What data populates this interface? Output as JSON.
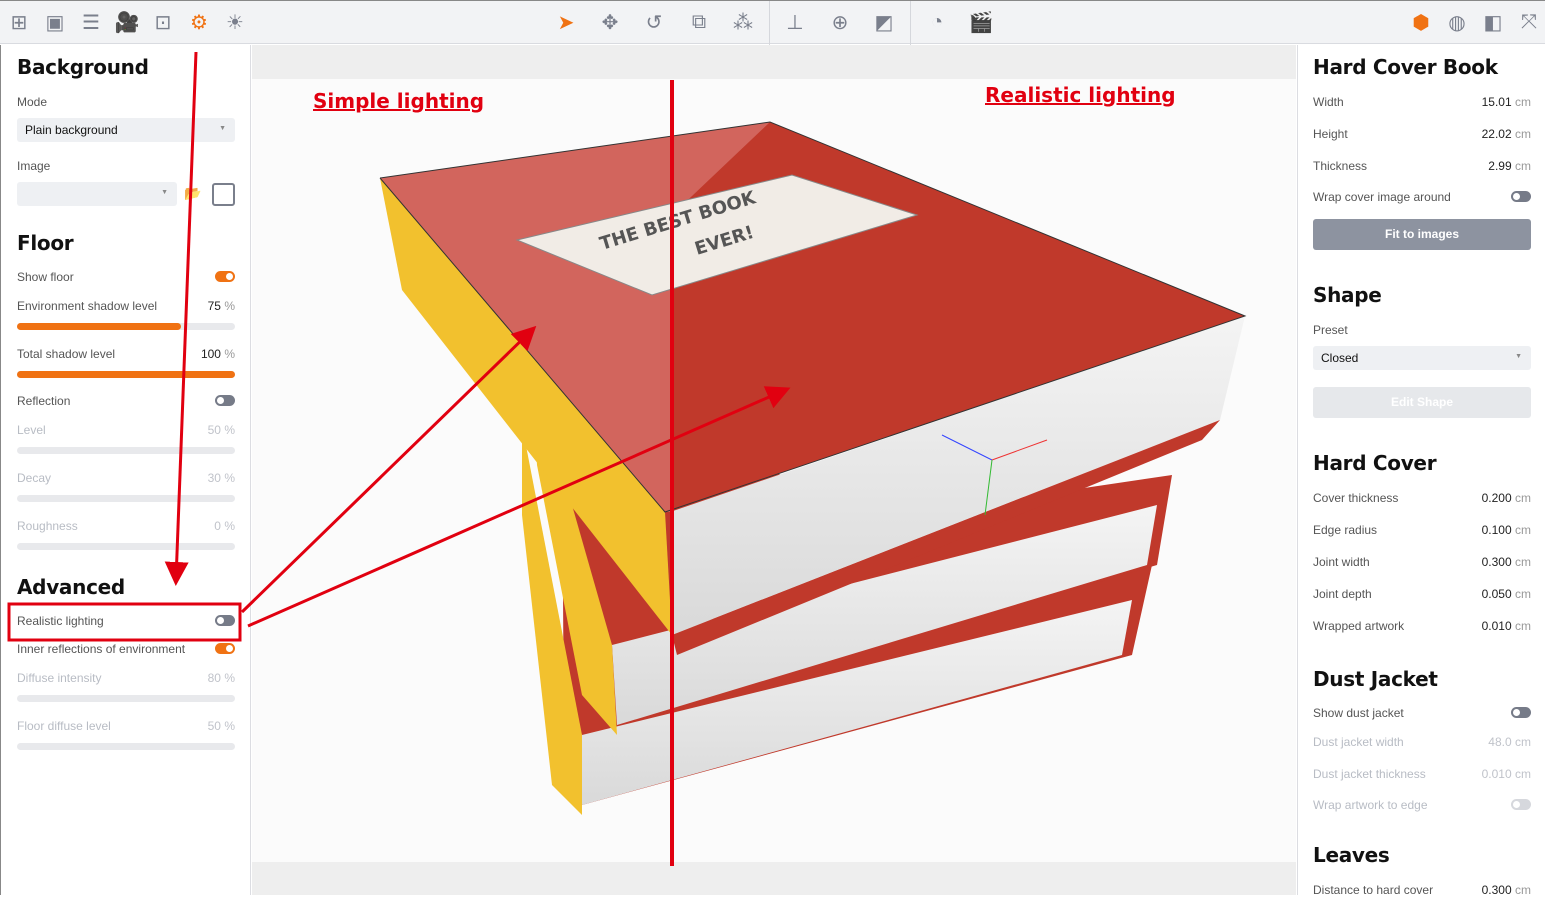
{
  "toolbar": {
    "left_icons": [
      "add-icon",
      "grid-icon",
      "list-icon",
      "camera-icon",
      "focus-icon",
      "settings-icon",
      "light-icon"
    ],
    "center_icons": [
      "select-arrow-icon",
      "move-icon",
      "rotate-icon",
      "scale-icon",
      "explode-icon",
      "drop-to-floor-icon",
      "zoom-object-icon",
      "material-icon",
      "timer-icon",
      "clapperboard-icon"
    ],
    "right_icons": [
      "object-cube-icon",
      "texture-icon",
      "layout-icon",
      "fullscreen-icon"
    ],
    "accent": "#f07213"
  },
  "left": {
    "background": {
      "title": "Background",
      "mode_label": "Mode",
      "mode_value": "Plain background",
      "image_label": "Image",
      "image_value": ""
    },
    "floor": {
      "title": "Floor",
      "show_floor": "Show floor",
      "show_floor_on": true,
      "env_shadow": "Environment shadow level",
      "env_shadow_val": "75",
      "env_shadow_level": 75,
      "total_shadow": "Total shadow level",
      "total_shadow_val": "100",
      "total_shadow_level": 100,
      "reflection": "Reflection",
      "reflection_on": false,
      "level": "Level",
      "level_val": "50",
      "decay": "Decay",
      "decay_val": "30",
      "roughness": "Roughness",
      "roughness_val": "0",
      "pct": "%"
    },
    "advanced": {
      "title": "Advanced",
      "realistic": "Realistic lighting",
      "realistic_on": false,
      "inner": "Inner reflections of environment",
      "inner_on": true,
      "diffuse": "Diffuse intensity",
      "diffuse_val": "80",
      "floor_diffuse": "Floor diffuse level",
      "floor_diffuse_val": "50",
      "pct": "%"
    }
  },
  "right": {
    "book": {
      "title": "Hard Cover Book",
      "width": "Width",
      "width_val": "15.01",
      "height": "Height",
      "height_val": "22.02",
      "thickness": "Thickness",
      "thickness_val": "2.99",
      "wrap": "Wrap cover image around",
      "fit": "Fit to images",
      "unit": "cm"
    },
    "shape": {
      "title": "Shape",
      "preset": "Preset",
      "preset_val": "Closed",
      "edit": "Edit Shape"
    },
    "hard": {
      "title": "Hard Cover",
      "rows": [
        {
          "l": "Cover thickness",
          "v": "0.200"
        },
        {
          "l": "Edge radius",
          "v": "0.100"
        },
        {
          "l": "Joint width",
          "v": "0.300"
        },
        {
          "l": "Joint depth",
          "v": "0.050"
        },
        {
          "l": "Wrapped artwork",
          "v": "0.010"
        }
      ]
    },
    "dust": {
      "title": "Dust Jacket",
      "show": "Show dust jacket",
      "width": "Dust jacket width",
      "width_val": "48.0",
      "thick": "Dust jacket thickness",
      "thick_val": "0.010",
      "wrap": "Wrap artwork to edge"
    },
    "leaves": {
      "title": "Leaves",
      "dist": "Distance to hard cover",
      "dist_val": "0.300"
    }
  },
  "viewport": {
    "simple": "Simple lighting",
    "realistic": "Realistic lighting",
    "cover_line1": "THE BEST BOOK",
    "cover_line2": "EVER!",
    "annotation_color": "#e10010"
  }
}
